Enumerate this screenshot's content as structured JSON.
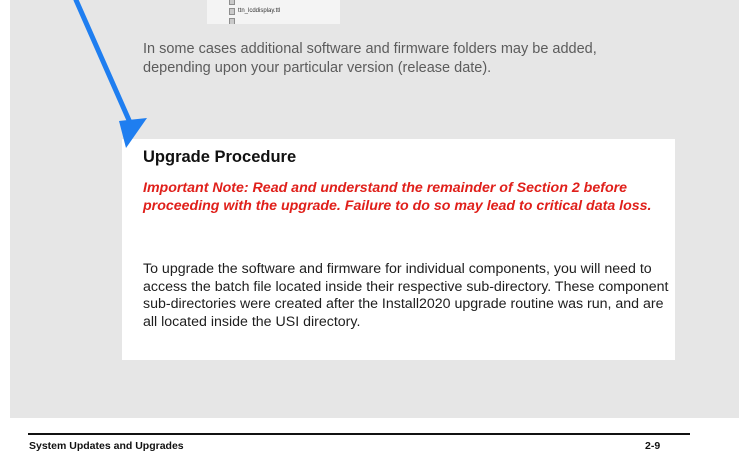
{
  "screenshot_thumbnail": {
    "files": [
      {
        "name": ""
      },
      {
        "name": "ttn_lcddisplay.ttl"
      },
      {
        "name": ""
      }
    ]
  },
  "intro_text": "In some cases additional software and firmware folders may be added, depending upon your particular version (release date).",
  "section": {
    "heading": "Upgrade Procedure",
    "important_note": "Important Note: Read and understand the remainder of Section 2 before proceeding with the upgrade. Failure to do so may lead to critical data loss.",
    "body": "To upgrade the software and firmware for individual components, you will need to access the batch file located inside their respective sub-directory. These component sub-directories were created after the Install2020 upgrade routine was run, and are all located inside the USI directory."
  },
  "footer": {
    "title": "System Updates and Upgrades",
    "page_number": "2-9"
  },
  "colors": {
    "page_background": "#e6e6e6",
    "card_background": "#ffffff",
    "note_red": "#e0201b",
    "arrow_blue": "#1f7ef0"
  },
  "icons": [
    "file-icon",
    "arrow-pointer-icon"
  ]
}
